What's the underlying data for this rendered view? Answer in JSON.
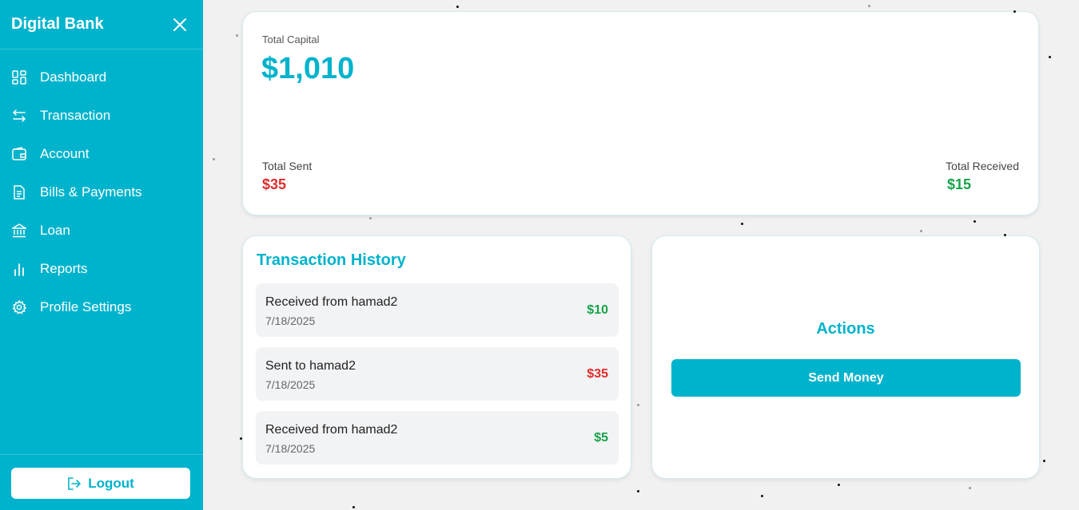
{
  "sidebar": {
    "brand": "Digital Bank",
    "items": [
      {
        "label": "Dashboard",
        "icon": "dashboard-grid-icon"
      },
      {
        "label": "Transaction",
        "icon": "arrows-swap-icon"
      },
      {
        "label": "Account",
        "icon": "wallet-icon"
      },
      {
        "label": "Bills & Payments",
        "icon": "document-icon"
      },
      {
        "label": "Loan",
        "icon": "bank-icon"
      },
      {
        "label": "Reports",
        "icon": "bar-chart-icon"
      },
      {
        "label": "Profile Settings",
        "icon": "gear-icon"
      }
    ],
    "logout_label": "Logout"
  },
  "capital": {
    "label": "Total Capital",
    "value": "$1,010",
    "sent_label": "Total Sent",
    "sent_value": "$35",
    "received_label": "Total Received",
    "received_value": "$15"
  },
  "history": {
    "title": "Transaction History",
    "items": [
      {
        "description": "Received from hamad2",
        "date": "7/18/2025",
        "amount": "$10",
        "direction": "in"
      },
      {
        "description": "Sent to hamad2",
        "date": "7/18/2025",
        "amount": "$35",
        "direction": "out"
      },
      {
        "description": "Received from hamad2",
        "date": "7/18/2025",
        "amount": "$5",
        "direction": "in"
      }
    ]
  },
  "actions": {
    "title": "Actions",
    "send_money_label": "Send Money"
  },
  "colors": {
    "accent": "#00b3cc",
    "positive": "#17a34a",
    "negative": "#e02c2c",
    "background": "#f1f1f2"
  }
}
